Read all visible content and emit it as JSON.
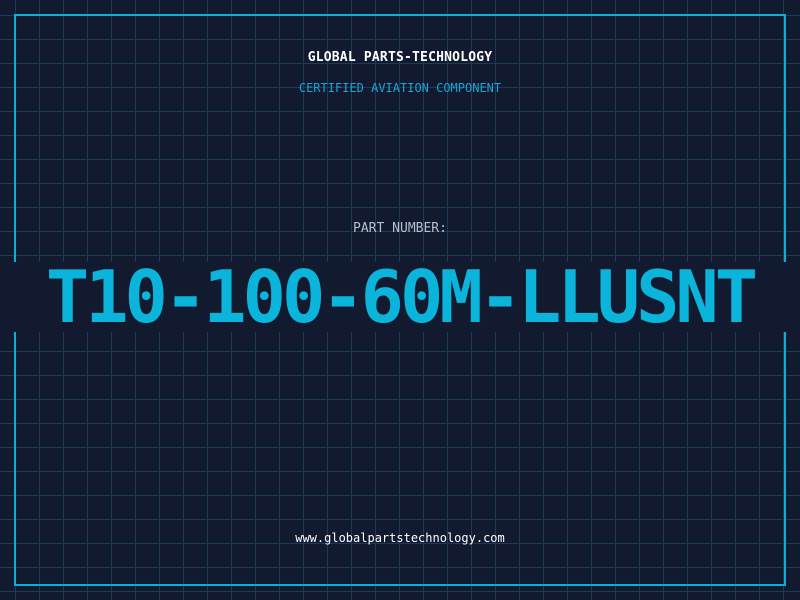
{
  "header": {
    "company": "GLOBAL PARTS-TECHNOLOGY",
    "subtitle": "CERTIFIED AVIATION COMPONENT"
  },
  "part": {
    "label": "PART NUMBER:",
    "number": "T10-100-60M-LLUSNT"
  },
  "footer": {
    "website": "www.globalpartstechnology.com"
  },
  "colors": {
    "background": "#111a2e",
    "grid": "#1d3a56",
    "accent": "#0ab4da",
    "text": "#ffffff",
    "muted": "#b7bfcc"
  }
}
